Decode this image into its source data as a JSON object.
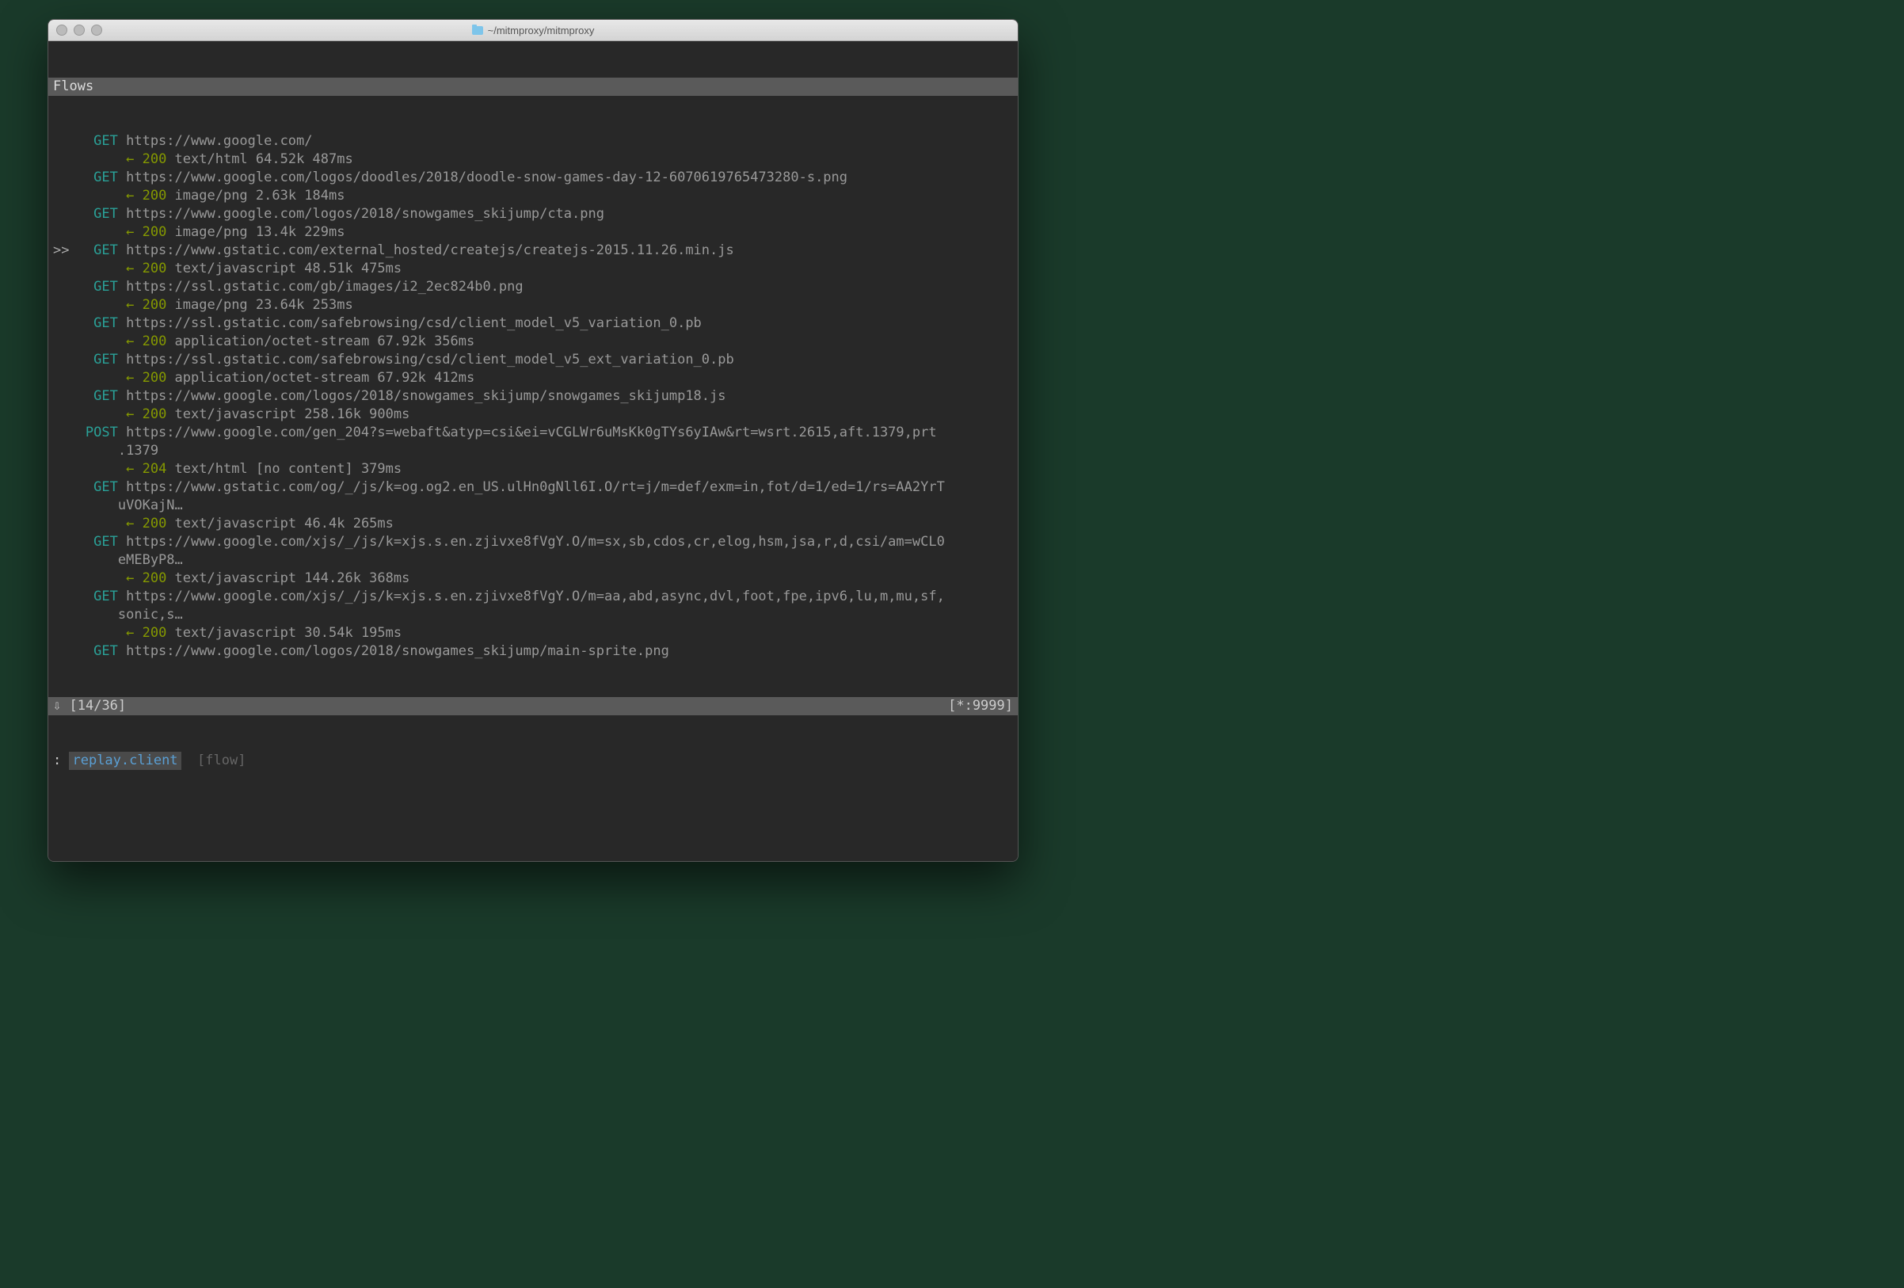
{
  "window": {
    "title": "~/mitmproxy/mitmproxy"
  },
  "header": "Flows",
  "flows": [
    {
      "selected": false,
      "method": "GET",
      "url": "https://www.google.com/",
      "status": "200",
      "meta": "text/html 64.52k 487ms"
    },
    {
      "selected": false,
      "method": "GET",
      "url": "https://www.google.com/logos/doodles/2018/doodle-snow-games-day-12-6070619765473280-s.png",
      "status": "200",
      "meta": "image/png 2.63k 184ms"
    },
    {
      "selected": false,
      "method": "GET",
      "url": "https://www.google.com/logos/2018/snowgames_skijump/cta.png",
      "status": "200",
      "meta": "image/png 13.4k 229ms"
    },
    {
      "selected": true,
      "method": "GET",
      "url": "https://www.gstatic.com/external_hosted/createjs/createjs-2015.11.26.min.js",
      "status": "200",
      "meta": "text/javascript 48.51k 475ms"
    },
    {
      "selected": false,
      "method": "GET",
      "url": "https://ssl.gstatic.com/gb/images/i2_2ec824b0.png",
      "status": "200",
      "meta": "image/png 23.64k 253ms"
    },
    {
      "selected": false,
      "method": "GET",
      "url": "https://ssl.gstatic.com/safebrowsing/csd/client_model_v5_variation_0.pb",
      "status": "200",
      "meta": "application/octet-stream 67.92k 356ms"
    },
    {
      "selected": false,
      "method": "GET",
      "url": "https://ssl.gstatic.com/safebrowsing/csd/client_model_v5_ext_variation_0.pb",
      "status": "200",
      "meta": "application/octet-stream 67.92k 412ms"
    },
    {
      "selected": false,
      "method": "GET",
      "url": "https://www.google.com/logos/2018/snowgames_skijump/snowgames_skijump18.js",
      "status": "200",
      "meta": "text/javascript 258.16k 900ms"
    },
    {
      "selected": false,
      "method": "POST",
      "url": "https://www.google.com/gen_204?s=webaft&atyp=csi&ei=vCGLWr6uMsKk0gTYs6yIAw&rt=wsrt.2615,aft.1379,prt",
      "url_cont": ".1379",
      "status": "204",
      "meta": "text/html [no content] 379ms"
    },
    {
      "selected": false,
      "method": "GET",
      "url": "https://www.gstatic.com/og/_/js/k=og.og2.en_US.ulHn0gNll6I.O/rt=j/m=def/exm=in,fot/d=1/ed=1/rs=AA2YrT",
      "url_cont": "uVOKajN…",
      "status": "200",
      "meta": "text/javascript 46.4k 265ms"
    },
    {
      "selected": false,
      "method": "GET",
      "url": "https://www.google.com/xjs/_/js/k=xjs.s.en.zjivxe8fVgY.O/m=sx,sb,cdos,cr,elog,hsm,jsa,r,d,csi/am=wCL0",
      "url_cont": "eMEByP8…",
      "status": "200",
      "meta": "text/javascript 144.26k 368ms"
    },
    {
      "selected": false,
      "method": "GET",
      "url": "https://www.google.com/xjs/_/js/k=xjs.s.en.zjivxe8fVgY.O/m=aa,abd,async,dvl,foot,fpe,ipv6,lu,m,mu,sf,",
      "url_cont": "sonic,s…",
      "status": "200",
      "meta": "text/javascript 30.54k 195ms"
    },
    {
      "selected": false,
      "method": "GET",
      "url": "https://www.google.com/logos/2018/snowgames_skijump/main-sprite.png",
      "status": null,
      "meta": null
    }
  ],
  "status_bar": {
    "left_icon": "⇩",
    "position": "[14/36]",
    "right": "[*:9999]"
  },
  "command": {
    "prompt": ":",
    "entry": "replay.client",
    "hint": "[flow]"
  }
}
